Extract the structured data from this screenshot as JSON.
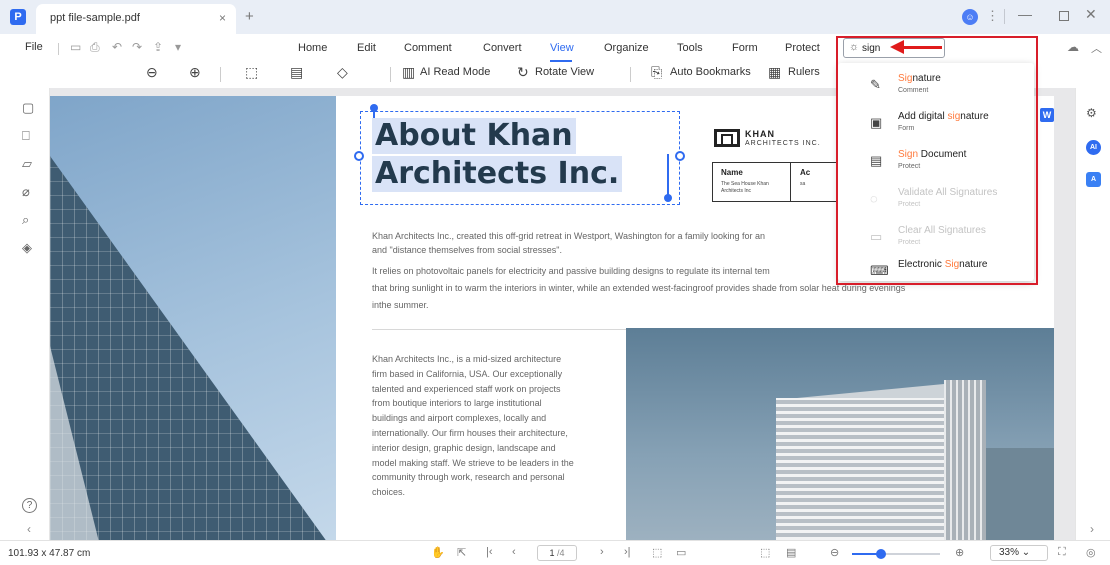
{
  "titlebar": {
    "tab_title": "ppt file-sample.pdf",
    "tab_close": "×",
    "new_tab": "+",
    "logo_icon": "app-logo-icon",
    "user_icon": "user-avatar-icon"
  },
  "menu": {
    "file": "File",
    "tabs": [
      "Home",
      "Edit",
      "Comment",
      "Convert",
      "View",
      "Organize",
      "Tools",
      "Form",
      "Protect"
    ],
    "active_tab": "View",
    "search_value": "sign"
  },
  "toolbar": {
    "ai_read_mode": "AI Read Mode",
    "rotate_view": "Rotate View",
    "auto_bookmarks": "Auto Bookmarks",
    "rulers": "Rulers"
  },
  "search_results": [
    {
      "pre": "",
      "hl": "Sig",
      "post": "nature",
      "sub": "Comment",
      "icon": "pen-sign-icon",
      "disabled": false
    },
    {
      "pre": "Add digital ",
      "hl": "sig",
      "post": "nature",
      "sub": "Form",
      "icon": "digital-signature-icon",
      "disabled": false
    },
    {
      "pre": "",
      "hl": "Sign",
      "post": " Document",
      "sub": "Protect",
      "icon": "sign-document-icon",
      "disabled": false
    },
    {
      "pre": "Validate All Signatures",
      "hl": "",
      "post": "",
      "sub": "Protect",
      "icon": "validate-icon",
      "disabled": true
    },
    {
      "pre": "Clear All Signatures",
      "hl": "",
      "post": "",
      "sub": "Protect",
      "icon": "clear-signatures-icon",
      "disabled": true
    },
    {
      "pre": "Electronic ",
      "hl": "Sig",
      "post": "nature",
      "sub": "",
      "icon": "electronic-signature-icon",
      "disabled": false
    }
  ],
  "document": {
    "heading_line1": "About Khan",
    "heading_line2": "Architects Inc.",
    "logo_name": "KHAN",
    "logo_sub": "ARCHITECTS INC.",
    "info_name_label": "Name",
    "info_name_value": "The Sea House Khan Architects Inc",
    "info_col2_label": "Ac",
    "info_col2_value": "sa",
    "para1_line1": "Khan Architects Inc., created this off-grid retreat in Westport, Washington for a family looking for an",
    "para1_line2": "and \"distance themselves from social stresses\".",
    "para2_line1": "It relies on photovoltaic panels for electricity and passive building designs to regulate its internal tem",
    "para2_line2": "that bring sunlight in to warm the interiors in winter, while an extended west-facingroof provides shade from solar heat during evenings",
    "para2_line3": "inthe summer.",
    "column_lines": [
      "Khan Architects Inc., is a mid-sized architecture",
      "firm based in California, USA. Our exceptionally",
      "talented and experienced staff work on projects",
      "from boutique interiors to large institutional",
      "buildings and airport complexes, locally and",
      "internationally. Our firm houses their architecture,",
      "interior design, graphic design, landscape and",
      "model making staff. We strieve to be leaders in the",
      "community through work, research and personal",
      "choices."
    ]
  },
  "statusbar": {
    "dimensions": "101.93 x 47.87 cm",
    "page_current": "1",
    "page_total": "/4",
    "zoom": "33%",
    "zoom_fraction": 0.33
  },
  "colors": {
    "accent": "#2f6bf0",
    "highlight": "#ff7a3d",
    "annotation_red": "#d81d2a"
  }
}
